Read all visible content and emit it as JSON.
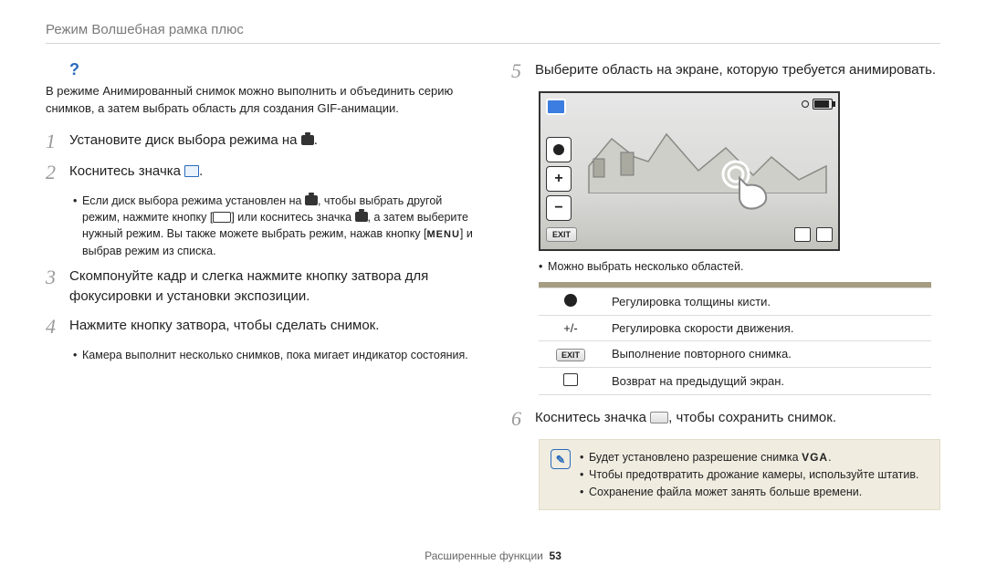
{
  "header": {
    "title": "Режим Волшебная рамка плюс"
  },
  "left": {
    "intro": "В режиме Анимированный снимок можно выполнить и объединить серию снимков, а затем выбрать область для создания GIF-анимации.",
    "steps": {
      "s1": {
        "num": "1",
        "text_a": "Установите диск выбора режима на ",
        "text_b": "."
      },
      "s2": {
        "num": "2",
        "text_a": "Коснитесь значка ",
        "text_b": "."
      },
      "s2_sub": {
        "a": "Если диск выбора режима установлен на ",
        "b": ", чтобы выбрать другой режим, нажмите кнопку [",
        "c": "] или коснитесь значка ",
        "d": ", а затем выберите нужный режим. Вы также можете выбрать режим, нажав кнопку [",
        "menu": "MENU",
        "e": "] и выбрав режим из списка."
      },
      "s3": {
        "num": "3",
        "text": "Скомпонуйте кадр и слегка нажмите кнопку затвора для фокусировки и установки экспозиции."
      },
      "s4": {
        "num": "4",
        "text": "Нажмите кнопку затвора, чтобы сделать снимок."
      },
      "s4_sub": "Камера выполнит несколько снимков, пока мигает индикатор состояния."
    }
  },
  "right": {
    "s5": {
      "num": "5",
      "text": "Выберите область на экране, которую требуется анимировать."
    },
    "preview_exit": "EXIT",
    "s5_sub": "Можно выбрать несколько областей.",
    "defs": {
      "r1": "Регулировка толщины кисти.",
      "r2_icon": "+/-",
      "r2": "Регулировка скорости движения.",
      "r3_icon": "EXIT",
      "r3": "Выполнение повторного снимка.",
      "r4": "Возврат на предыдущий экран."
    },
    "s6": {
      "num": "6",
      "text_a": "Коснитесь значка ",
      "text_b": ", чтобы сохранить снимок."
    },
    "note": {
      "l1a": "Будет установлено разрешение снимка ",
      "l1v": "VGA",
      "l1b": ".",
      "l2": "Чтобы предотвратить дрожание камеры, используйте штатив.",
      "l3": "Сохранение файла может занять больше времени."
    }
  },
  "footer": {
    "section": "Расширенные функции",
    "page": "53"
  }
}
